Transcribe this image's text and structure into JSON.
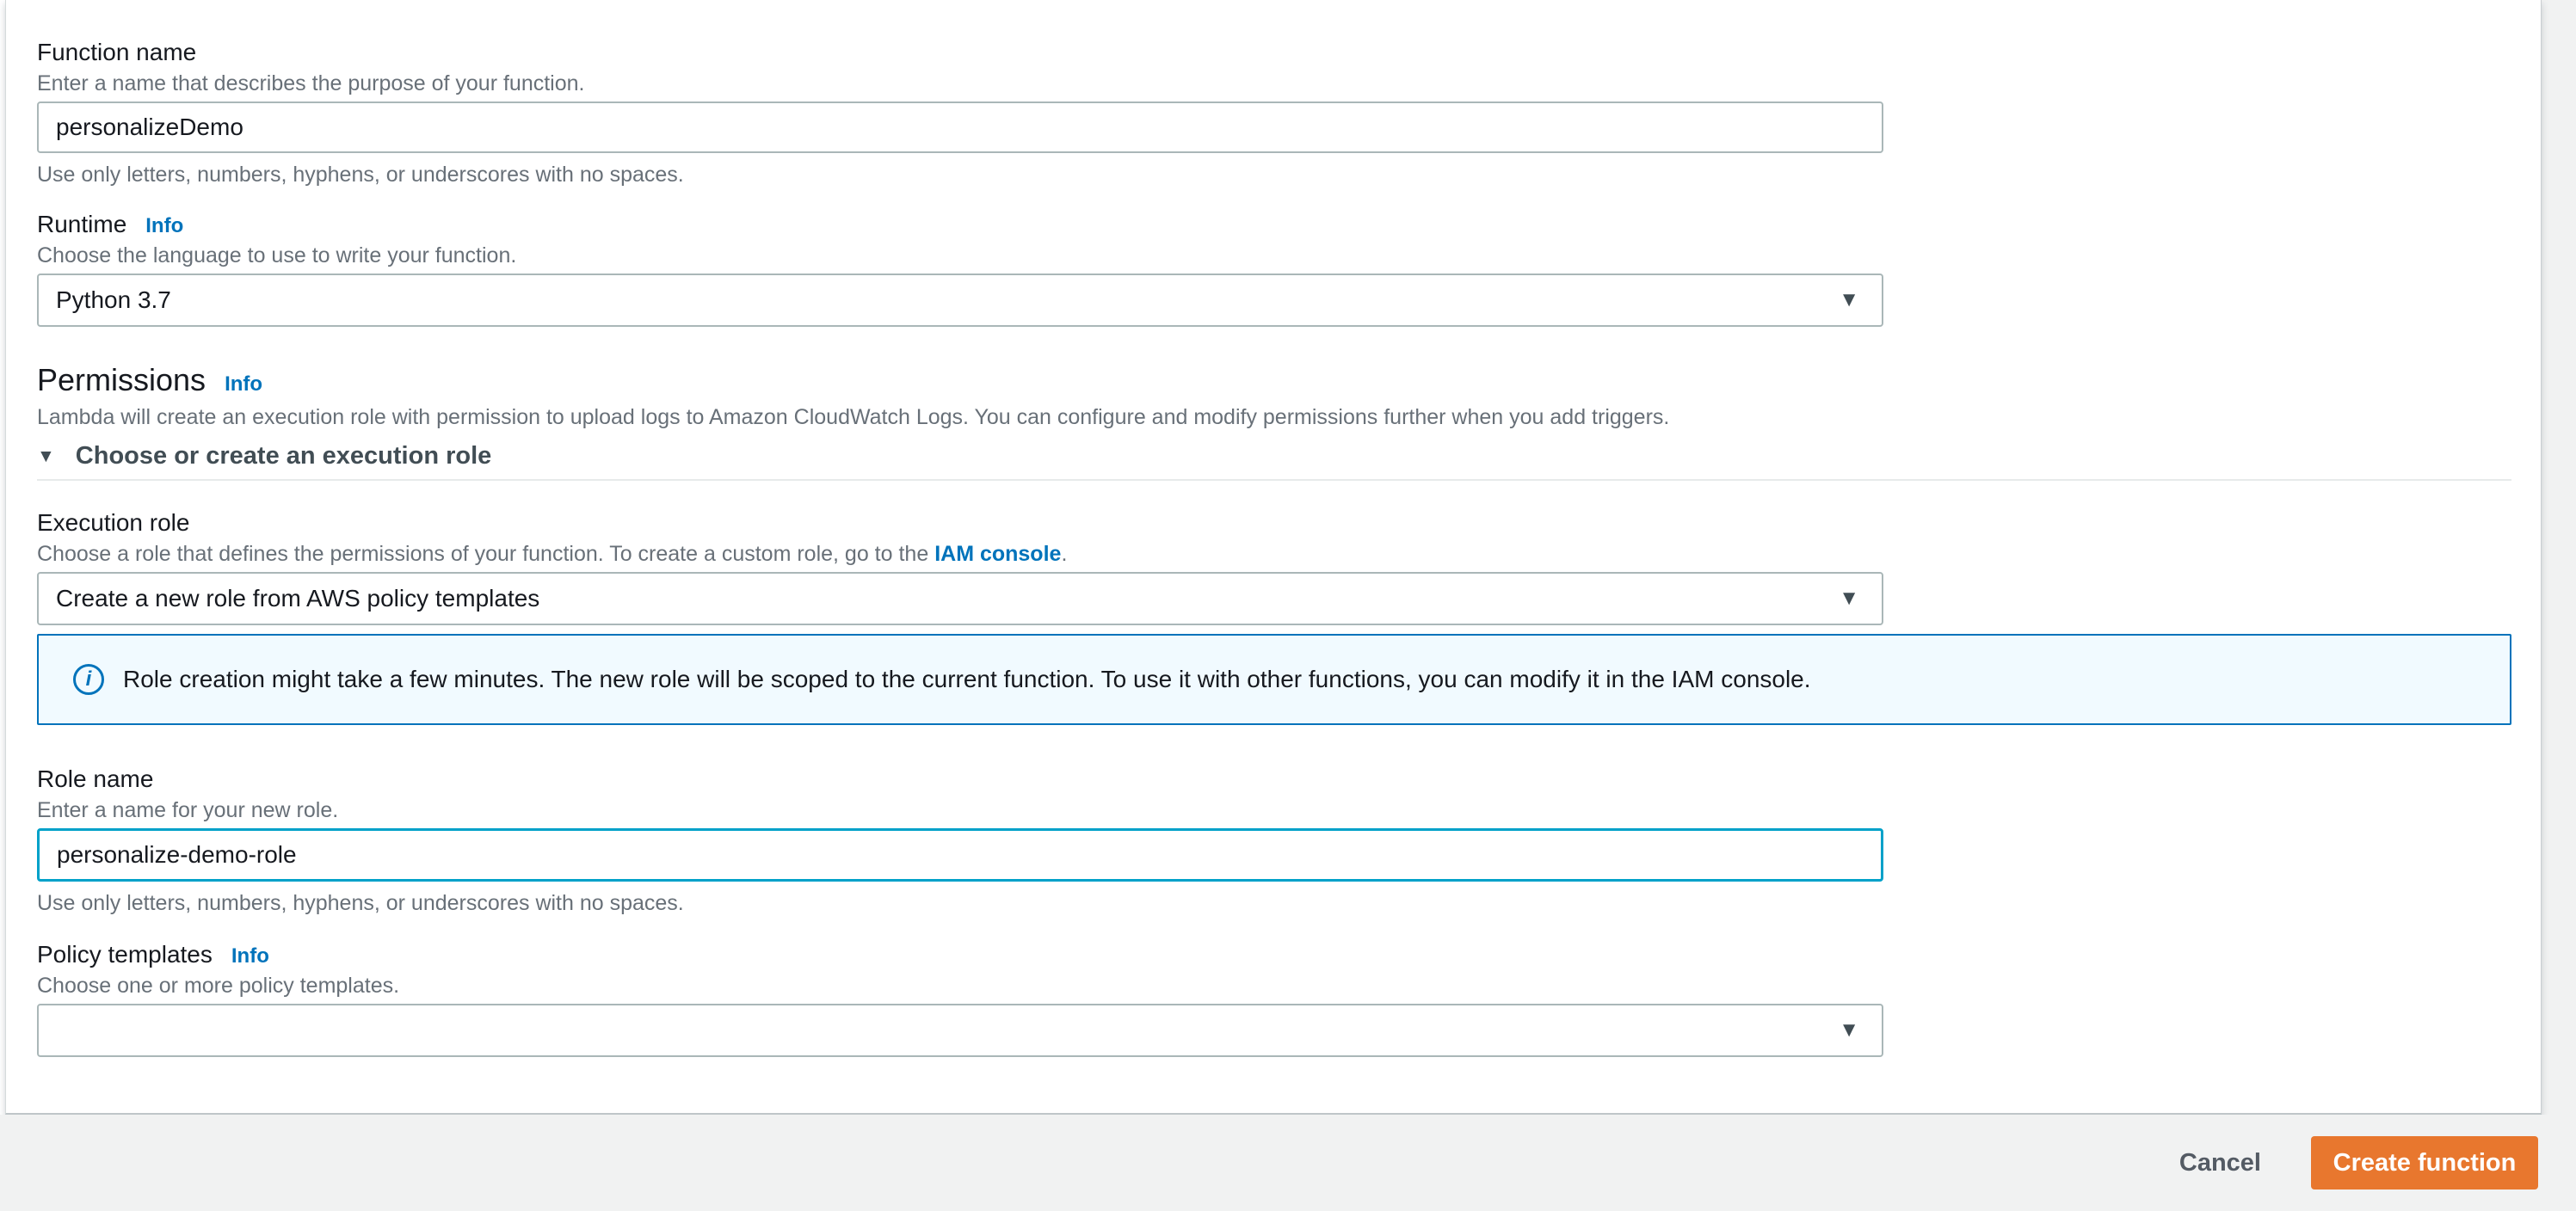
{
  "colors": {
    "accent_orange": "#e8772e",
    "link_blue": "#0073bb",
    "focus_blue": "#00a1c9",
    "alert_background": "#f1faff",
    "page_background": "#f1f2f2"
  },
  "form": {
    "function_name": {
      "label": "Function name",
      "description": "Enter a name that describes the purpose of your function.",
      "value": "personalizeDemo",
      "constraint": "Use only letters, numbers, hyphens, or underscores with no spaces."
    },
    "runtime": {
      "label": "Runtime",
      "info_label": "Info",
      "description": "Choose the language to use to write your function.",
      "value": "Python 3.7"
    },
    "permissions": {
      "heading": "Permissions",
      "info_label": "Info",
      "description": "Lambda will create an execution role with permission to upload logs to Amazon CloudWatch Logs. You can configure and modify permissions further when you add triggers.",
      "expander_label": "Choose or create an execution role"
    },
    "execution_role": {
      "label": "Execution role",
      "description_prefix": "Choose a role that defines the permissions of your function. To create a custom role, go to the ",
      "link_text": "IAM console",
      "description_suffix": ".",
      "value": "Create a new role from AWS policy templates"
    },
    "role_alert": {
      "icon_glyph": "i",
      "text": "Role creation might take a few minutes. The new role will be scoped to the current function. To use it with other functions, you can modify it in the IAM console."
    },
    "role_name": {
      "label": "Role name",
      "description": "Enter a name for your new role.",
      "value": "personalize-demo-role",
      "constraint": "Use only letters, numbers, hyphens, or underscores with no spaces."
    },
    "policy_templates": {
      "label": "Policy templates",
      "info_label": "Info",
      "description": "Choose one or more policy templates.",
      "value": ""
    }
  },
  "icons": {
    "select_caret": "▼",
    "expander_caret": "▼"
  },
  "footer": {
    "cancel_label": "Cancel",
    "submit_label": "Create function"
  }
}
